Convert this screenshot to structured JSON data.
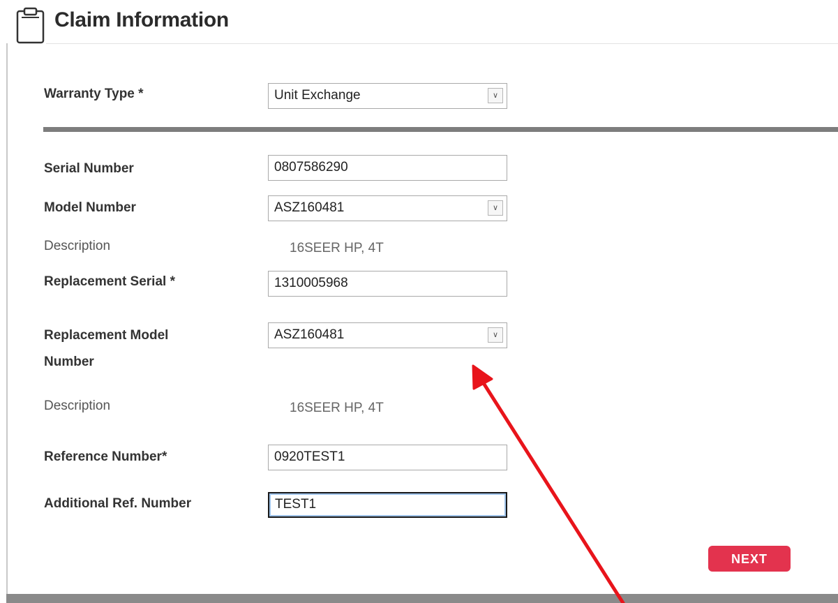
{
  "header": {
    "title": "Claim Information",
    "icon": "clipboard-icon"
  },
  "form": {
    "warranty_type": {
      "label": "Warranty Type *",
      "value": "Unit Exchange"
    },
    "serial_number": {
      "label": "Serial Number",
      "value": "0807586290"
    },
    "model_number": {
      "label": "Model Number",
      "value": "ASZ160481"
    },
    "model_description": {
      "label": "Description",
      "value": "16SEER HP, 4T"
    },
    "replacement_serial": {
      "label": "Replacement Serial *",
      "value": "1310005968"
    },
    "replacement_model_number": {
      "label_line1": "Replacement Model",
      "label_line2": "Number",
      "value": "ASZ160481"
    },
    "replacement_description": {
      "label": "Description",
      "value": "16SEER HP, 4T"
    },
    "reference_number": {
      "label": "Reference Number*",
      "value": "0920TEST1"
    },
    "additional_ref_number": {
      "label": "Additional Ref. Number",
      "value": "TEST1"
    }
  },
  "actions": {
    "next_label": "NEXT"
  },
  "colors": {
    "next_button": "#e3334e",
    "annotation_arrow": "#e8141b",
    "divider": "#7d7d7d"
  }
}
